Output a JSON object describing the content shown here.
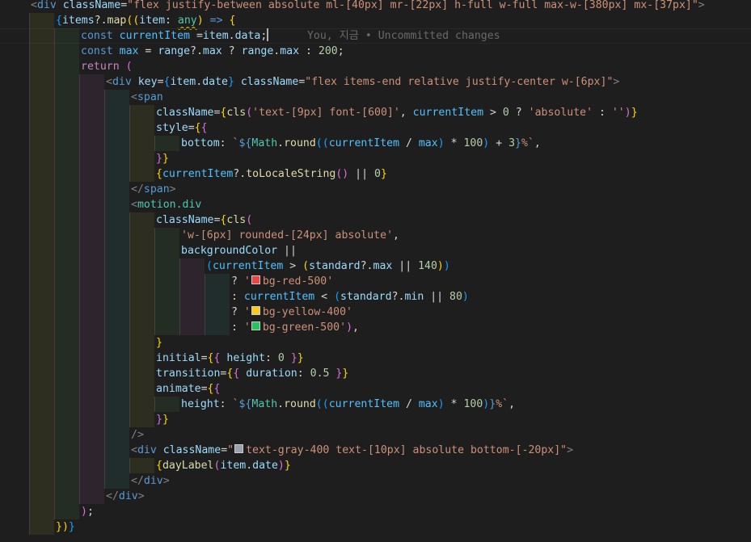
{
  "editor": {
    "blame_annotation": "You, 지금 • Uncommitted changes",
    "swatch_colors": {
      "red": "#ef4444",
      "yellow": "#facc15",
      "green": "#22c55e",
      "gray": "#9ca3af"
    },
    "lines": [
      {
        "indent": 1,
        "tokens": [
          [
            "t-angle",
            "<"
          ],
          [
            "t-tag",
            "div"
          ],
          [
            "t-plain",
            " "
          ],
          [
            "t-attr",
            "className"
          ],
          [
            "t-plain",
            "="
          ],
          [
            "t-str",
            "\"flex justify-between absolute ml-[40px] mr-[22px] h-full w-full max-w-[380px] mx-[37px]\""
          ],
          [
            "t-angle",
            ">"
          ]
        ]
      },
      {
        "indent": 2,
        "tokens": [
          [
            "t-bracket3",
            "{"
          ],
          [
            "t-var",
            "items"
          ],
          [
            "t-plain",
            "?."
          ],
          [
            "t-fn",
            "map"
          ],
          [
            "t-bracket1",
            "(("
          ],
          [
            "t-var",
            "item"
          ],
          [
            "t-plain",
            ": "
          ],
          [
            "t-type squiggle",
            "any"
          ],
          [
            "t-bracket1",
            ")"
          ],
          [
            "t-plain",
            " "
          ],
          [
            "t-kw",
            "=>"
          ],
          [
            "t-plain",
            " "
          ],
          [
            "t-bracket1",
            "{"
          ]
        ]
      },
      {
        "indent": 3,
        "current": true,
        "tokens": [
          [
            "t-kw",
            "const"
          ],
          [
            "t-plain",
            " "
          ],
          [
            "t-const",
            "currentItem"
          ],
          [
            "t-plain",
            " ="
          ],
          [
            "t-var",
            "item"
          ],
          [
            "t-plain",
            "."
          ],
          [
            "t-var",
            "data"
          ],
          [
            "t-plain",
            ";"
          ],
          [
            "cursor",
            ""
          ],
          [
            "blame",
            "      "
          ]
        ]
      },
      {
        "indent": 3,
        "tokens": [
          [
            "t-kw",
            "const"
          ],
          [
            "t-plain",
            " "
          ],
          [
            "t-const",
            "max"
          ],
          [
            "t-plain",
            " = "
          ],
          [
            "t-var",
            "range"
          ],
          [
            "t-plain",
            "?."
          ],
          [
            "t-var",
            "max"
          ],
          [
            "t-plain",
            " ? "
          ],
          [
            "t-var",
            "range"
          ],
          [
            "t-plain",
            "."
          ],
          [
            "t-var",
            "max"
          ],
          [
            "t-plain",
            " : "
          ],
          [
            "t-num",
            "200"
          ],
          [
            "t-plain",
            ";"
          ]
        ]
      },
      {
        "indent": 3,
        "tokens": [
          [
            "t-ctrl",
            "return"
          ],
          [
            "t-plain",
            " "
          ],
          [
            "t-bracket2",
            "("
          ]
        ]
      },
      {
        "indent": 4,
        "tokens": [
          [
            "t-angle",
            "<"
          ],
          [
            "t-tag",
            "div"
          ],
          [
            "t-plain",
            " "
          ],
          [
            "t-attr",
            "key"
          ],
          [
            "t-plain",
            "="
          ],
          [
            "t-bracket3",
            "{"
          ],
          [
            "t-var",
            "item"
          ],
          [
            "t-plain",
            "."
          ],
          [
            "t-var",
            "date"
          ],
          [
            "t-bracket3",
            "}"
          ],
          [
            "t-plain",
            " "
          ],
          [
            "t-attr",
            "className"
          ],
          [
            "t-plain",
            "="
          ],
          [
            "t-str",
            "\"flex items-end relative justify-center w-[6px]\""
          ],
          [
            "t-angle",
            ">"
          ]
        ]
      },
      {
        "indent": 5,
        "tokens": [
          [
            "t-angle",
            "<"
          ],
          [
            "t-tag",
            "span"
          ]
        ]
      },
      {
        "indent": 6,
        "tokens": [
          [
            "t-attr",
            "className"
          ],
          [
            "t-plain",
            "="
          ],
          [
            "t-bracket1",
            "{"
          ],
          [
            "t-fn",
            "cls"
          ],
          [
            "t-bracket2",
            "("
          ],
          [
            "t-str",
            "'text-[9px] font-[600]'"
          ],
          [
            "t-plain",
            ", "
          ],
          [
            "t-const",
            "currentItem"
          ],
          [
            "t-plain",
            " > "
          ],
          [
            "t-num",
            "0"
          ],
          [
            "t-plain",
            " ? "
          ],
          [
            "t-str",
            "'absolute'"
          ],
          [
            "t-plain",
            " : "
          ],
          [
            "t-str",
            "''"
          ],
          [
            "t-bracket2",
            ")"
          ],
          [
            "t-bracket1",
            "}"
          ]
        ]
      },
      {
        "indent": 6,
        "tokens": [
          [
            "t-attr",
            "style"
          ],
          [
            "t-plain",
            "="
          ],
          [
            "t-bracket1",
            "{"
          ],
          [
            "t-bracket2",
            "{"
          ]
        ]
      },
      {
        "indent": 7,
        "tokens": [
          [
            "t-var",
            "bottom"
          ],
          [
            "t-plain",
            ": "
          ],
          [
            "t-str",
            "`"
          ],
          [
            "t-kw",
            "${"
          ],
          [
            "t-type",
            "Math"
          ],
          [
            "t-plain",
            "."
          ],
          [
            "t-fn",
            "round"
          ],
          [
            "t-bracket3",
            "(("
          ],
          [
            "t-const",
            "currentItem"
          ],
          [
            "t-plain",
            " / "
          ],
          [
            "t-const",
            "max"
          ],
          [
            "t-bracket3",
            ")"
          ],
          [
            "t-plain",
            " * "
          ],
          [
            "t-num",
            "100"
          ],
          [
            "t-bracket3",
            ")"
          ],
          [
            "t-plain",
            " + "
          ],
          [
            "t-num",
            "3"
          ],
          [
            "t-kw",
            "}"
          ],
          [
            "t-str",
            "%`"
          ],
          [
            "t-plain",
            ","
          ]
        ]
      },
      {
        "indent": 6,
        "tokens": [
          [
            "t-bracket2",
            "}"
          ],
          [
            "t-bracket1",
            "}"
          ]
        ]
      },
      {
        "indent": 6,
        "tokens": [
          [
            "t-bracket1",
            "{"
          ],
          [
            "t-const",
            "currentItem"
          ],
          [
            "t-plain",
            "?."
          ],
          [
            "t-fn",
            "toLocaleString"
          ],
          [
            "t-bracket2",
            "()"
          ],
          [
            "t-plain",
            " || "
          ],
          [
            "t-num",
            "0"
          ],
          [
            "t-bracket1",
            "}"
          ]
        ]
      },
      {
        "indent": 5,
        "tokens": [
          [
            "t-angle",
            "</"
          ],
          [
            "t-tag",
            "span"
          ],
          [
            "t-angle",
            ">"
          ]
        ]
      },
      {
        "indent": 5,
        "tokens": [
          [
            "t-angle",
            "<"
          ],
          [
            "t-type",
            "motion.div"
          ]
        ]
      },
      {
        "indent": 6,
        "tokens": [
          [
            "t-attr",
            "className"
          ],
          [
            "t-plain",
            "="
          ],
          [
            "t-bracket1",
            "{"
          ],
          [
            "t-fn",
            "cls"
          ],
          [
            "t-bracket2",
            "("
          ]
        ]
      },
      {
        "indent": 7,
        "tokens": [
          [
            "t-str",
            "'w-[6px] rounded-[24px] absolute'"
          ],
          [
            "t-plain",
            ","
          ]
        ]
      },
      {
        "indent": 7,
        "tokens": [
          [
            "t-var",
            "backgroundColor"
          ],
          [
            "t-plain",
            " ||"
          ]
        ]
      },
      {
        "indent": 8,
        "tokens": [
          [
            "t-bracket3",
            "("
          ],
          [
            "t-const",
            "currentItem"
          ],
          [
            "t-plain",
            " > "
          ],
          [
            "t-bracket1",
            "("
          ],
          [
            "t-var",
            "standard"
          ],
          [
            "t-plain",
            "?."
          ],
          [
            "t-var",
            "max"
          ],
          [
            "t-plain",
            " || "
          ],
          [
            "t-num",
            "140"
          ],
          [
            "t-bracket1",
            ")"
          ],
          [
            "t-bracket3",
            ")"
          ]
        ]
      },
      {
        "indent": 9,
        "tokens": [
          [
            "t-plain",
            "? "
          ],
          [
            "t-str",
            "'"
          ],
          [
            "swatch",
            "red"
          ],
          [
            "t-str",
            "bg-red-500'"
          ]
        ]
      },
      {
        "indent": 9,
        "tokens": [
          [
            "t-plain",
            ": "
          ],
          [
            "t-const",
            "currentItem"
          ],
          [
            "t-plain",
            " < "
          ],
          [
            "t-bracket3",
            "("
          ],
          [
            "t-var",
            "standard"
          ],
          [
            "t-plain",
            "?."
          ],
          [
            "t-var",
            "min"
          ],
          [
            "t-plain",
            " || "
          ],
          [
            "t-num",
            "80"
          ],
          [
            "t-bracket3",
            ")"
          ]
        ]
      },
      {
        "indent": 9,
        "tokens": [
          [
            "t-plain",
            "? "
          ],
          [
            "t-str",
            "'"
          ],
          [
            "swatch",
            "yellow"
          ],
          [
            "t-str",
            "bg-yellow-400'"
          ]
        ]
      },
      {
        "indent": 9,
        "tokens": [
          [
            "t-plain",
            ": "
          ],
          [
            "t-str",
            "'"
          ],
          [
            "swatch",
            "green"
          ],
          [
            "t-str",
            "bg-green-500'"
          ],
          [
            "t-bracket2",
            ")"
          ],
          [
            "t-plain",
            ","
          ]
        ]
      },
      {
        "indent": 6,
        "tokens": [
          [
            "t-bracket1",
            "}"
          ]
        ]
      },
      {
        "indent": 6,
        "tokens": [
          [
            "t-attr",
            "initial"
          ],
          [
            "t-plain",
            "="
          ],
          [
            "t-bracket1",
            "{"
          ],
          [
            "t-bracket2",
            "{"
          ],
          [
            "t-plain",
            " "
          ],
          [
            "t-var",
            "height"
          ],
          [
            "t-plain",
            ": "
          ],
          [
            "t-num",
            "0"
          ],
          [
            "t-plain",
            " "
          ],
          [
            "t-bracket2",
            "}"
          ],
          [
            "t-bracket1",
            "}"
          ]
        ]
      },
      {
        "indent": 6,
        "tokens": [
          [
            "t-attr",
            "transition"
          ],
          [
            "t-plain",
            "="
          ],
          [
            "t-bracket1",
            "{"
          ],
          [
            "t-bracket2",
            "{"
          ],
          [
            "t-plain",
            " "
          ],
          [
            "t-var",
            "duration"
          ],
          [
            "t-plain",
            ": "
          ],
          [
            "t-num",
            "0.5"
          ],
          [
            "t-plain",
            " "
          ],
          [
            "t-bracket2",
            "}"
          ],
          [
            "t-bracket1",
            "}"
          ]
        ]
      },
      {
        "indent": 6,
        "tokens": [
          [
            "t-attr",
            "animate"
          ],
          [
            "t-plain",
            "="
          ],
          [
            "t-bracket1",
            "{"
          ],
          [
            "t-bracket2",
            "{"
          ]
        ]
      },
      {
        "indent": 7,
        "tokens": [
          [
            "t-var",
            "height"
          ],
          [
            "t-plain",
            ": "
          ],
          [
            "t-str",
            "`"
          ],
          [
            "t-kw",
            "${"
          ],
          [
            "t-type",
            "Math"
          ],
          [
            "t-plain",
            "."
          ],
          [
            "t-fn",
            "round"
          ],
          [
            "t-bracket3",
            "(("
          ],
          [
            "t-const",
            "currentItem"
          ],
          [
            "t-plain",
            " / "
          ],
          [
            "t-const",
            "max"
          ],
          [
            "t-bracket3",
            ")"
          ],
          [
            "t-plain",
            " * "
          ],
          [
            "t-num",
            "100"
          ],
          [
            "t-bracket3",
            ")"
          ],
          [
            "t-kw",
            "}"
          ],
          [
            "t-str",
            "%`"
          ],
          [
            "t-plain",
            ","
          ]
        ]
      },
      {
        "indent": 6,
        "tokens": [
          [
            "t-bracket2",
            "}"
          ],
          [
            "t-bracket1",
            "}"
          ]
        ]
      },
      {
        "indent": 5,
        "tokens": [
          [
            "t-angle",
            "/>"
          ]
        ]
      },
      {
        "indent": 5,
        "tokens": [
          [
            "t-angle",
            "<"
          ],
          [
            "t-tag",
            "div"
          ],
          [
            "t-plain",
            " "
          ],
          [
            "t-attr",
            "className"
          ],
          [
            "t-plain",
            "="
          ],
          [
            "t-str",
            "\""
          ],
          [
            "swatch",
            "gray"
          ],
          [
            "t-str",
            "text-gray-400 text-[10px] absolute bottom-[-20px]\""
          ],
          [
            "t-angle",
            ">"
          ]
        ]
      },
      {
        "indent": 6,
        "tokens": [
          [
            "t-bracket1",
            "{"
          ],
          [
            "t-fn",
            "dayLabel"
          ],
          [
            "t-bracket2",
            "("
          ],
          [
            "t-var",
            "item"
          ],
          [
            "t-plain",
            "."
          ],
          [
            "t-var",
            "date"
          ],
          [
            "t-bracket2",
            ")"
          ],
          [
            "t-bracket1",
            "}"
          ]
        ]
      },
      {
        "indent": 5,
        "tokens": [
          [
            "t-angle",
            "</"
          ],
          [
            "t-tag",
            "div"
          ],
          [
            "t-angle",
            ">"
          ]
        ]
      },
      {
        "indent": 4,
        "tokens": [
          [
            "t-angle",
            "</"
          ],
          [
            "t-tag",
            "div"
          ],
          [
            "t-angle",
            ">"
          ]
        ]
      },
      {
        "indent": 3,
        "tokens": [
          [
            "t-bracket2",
            ")"
          ],
          [
            "t-plain",
            ";"
          ]
        ]
      },
      {
        "indent": 2,
        "tokens": [
          [
            "t-bracket1",
            "}"
          ],
          [
            "t-bracket1",
            ")"
          ],
          [
            "t-bracket3",
            "}"
          ]
        ]
      }
    ]
  }
}
